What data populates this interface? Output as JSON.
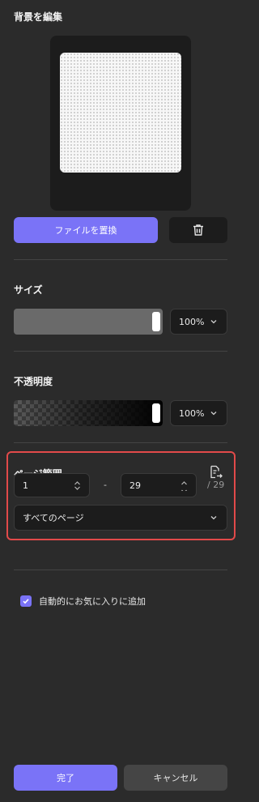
{
  "background": {
    "title": "背景を編集",
    "replace_file_label": "ファイルを置換"
  },
  "size": {
    "title": "サイズ",
    "value": "100%",
    "slider_level": 1.0
  },
  "opacity": {
    "title": "不透明度",
    "value": "100%",
    "slider_level": 1.0
  },
  "page_range": {
    "title": "ページ範囲",
    "from": "1",
    "separator": "-",
    "to": "29",
    "total": "/ 29",
    "selection": "すべてのページ"
  },
  "favorites": {
    "label": "自動的にお気に入りに追加",
    "checked": true
  },
  "footer": {
    "done_label": "完了",
    "cancel_label": "キャンセル"
  },
  "colors": {
    "accent": "#7a73f7",
    "highlight": "#e24a4a",
    "panel": "#2b2b2b",
    "field": "#1c1c1c"
  },
  "icons": [
    "trash-icon",
    "chevron-down-icon",
    "spin-up-icon",
    "spin-down-icon",
    "page-swap-icon",
    "check-icon"
  ]
}
